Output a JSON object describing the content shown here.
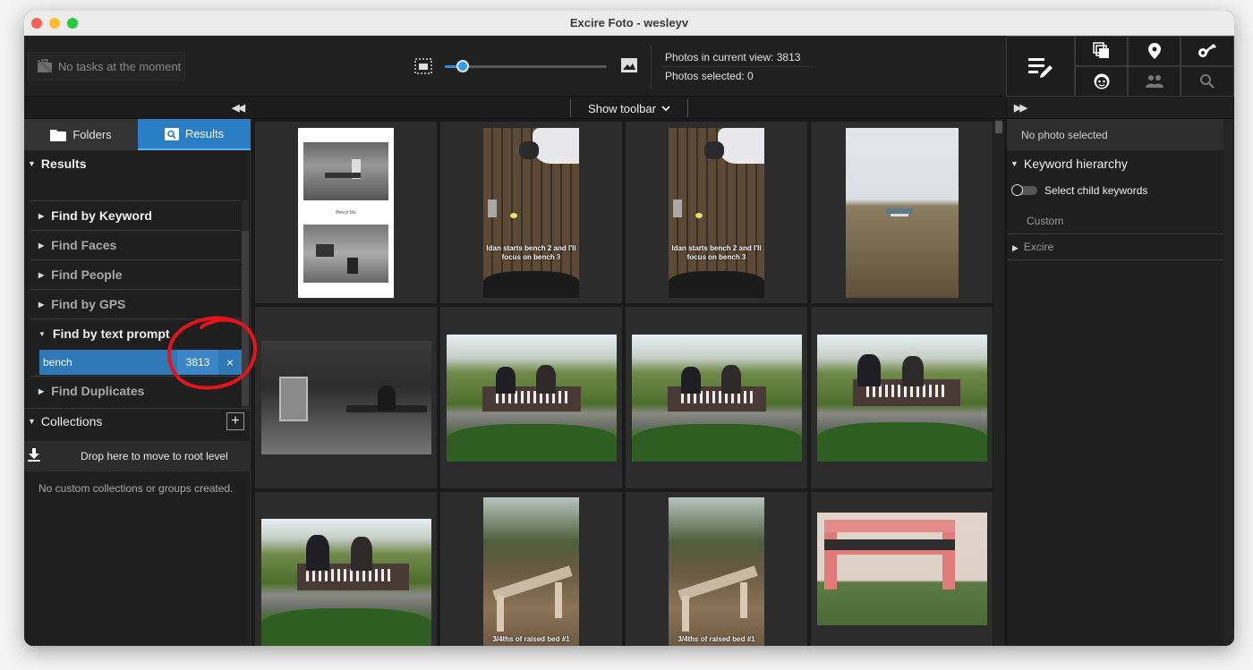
{
  "window": {
    "title": "Excire Foto - wesleyv"
  },
  "topbar": {
    "tasks_status": "No tasks at the moment",
    "zoom_slider_fraction": 0.11,
    "photos_in_view": "Photos in current view: 3813",
    "photos_selected": "Photos selected: 0",
    "tools": [
      "edit-keywords-icon",
      "duplicates-icon",
      "location-pin-icon",
      "key-icon",
      "face-icon",
      "people-icon",
      "search-icon"
    ]
  },
  "left": {
    "collapse_glyph": "◀◀",
    "tabs": [
      {
        "label": "Folders",
        "icon": "folder-icon"
      },
      {
        "label": "Results",
        "icon": "results-search-icon"
      }
    ],
    "results_header": "Results",
    "find_items": {
      "keyword": "Find by Keyword",
      "faces": "Find Faces",
      "people": "Find People",
      "gps": "Find by GPS",
      "text_prompt": "Find by text prompt",
      "duplicates": "Find Duplicates"
    },
    "query": {
      "text": "bench",
      "count": "3813",
      "remove": "×"
    },
    "collections_header": "Collections",
    "collections_add": "+",
    "drop_zone": "Drop here to move to root level",
    "no_collections": "No custom collections or groups created."
  },
  "center": {
    "show_toolbar": "Show toolbar",
    "captions": {
      "bench2_a": "Idan starts bench 2 and I'll focus on bench 3",
      "bench2_b": "Idan starts bench 2 and I'll focus on bench 3",
      "raised_a": "3/4ths of raised bed #1",
      "raised_b": "3/4ths of raised bed #1",
      "doc_text": "Bench Me"
    }
  },
  "right": {
    "collapse_glyph": "▶▶",
    "no_photo": "No photo selected",
    "keyword_hierarchy": "Keyword hierarchy",
    "select_child": "Select child keywords",
    "custom": "Custom",
    "excire": "Excire"
  },
  "colors": {
    "accent": "#2a7ec6",
    "background": "#1e1e1e",
    "annotation": "#e3141b"
  }
}
